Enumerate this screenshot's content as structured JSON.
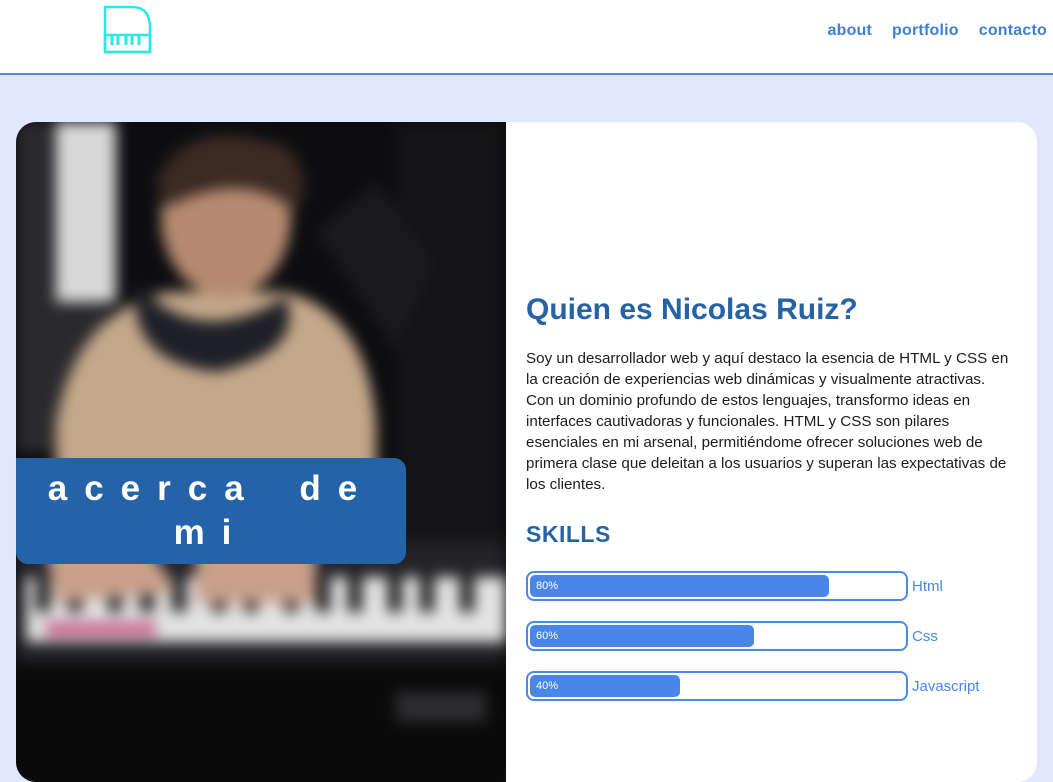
{
  "header": {
    "logo_icon": "piano-icon",
    "nav": [
      {
        "label": "about"
      },
      {
        "label": "portfolio"
      },
      {
        "label": "contacto"
      }
    ]
  },
  "about_badge": "acerca de mi",
  "profile": {
    "title": "Quien es Nicolas Ruiz?",
    "bio": "Soy un desarrollador web y aquí destaco la esencia de HTML y CSS en la creación de experiencias web dinámicas y visualmente atractivas. Con un dominio profundo de estos lenguajes, transformo ideas en interfaces cautivadoras y funcionales. HTML y CSS son pilares esenciales en mi arsenal, permitiéndome ofrecer soluciones web de primera clase que deleitan a los usuarios y superan las expectativas de los clientes."
  },
  "skills": {
    "title": "SKILLS",
    "items": [
      {
        "name": "Html",
        "percent": 80,
        "label": "80%"
      },
      {
        "name": "Css",
        "percent": 60,
        "label": "60%"
      },
      {
        "name": "Javascript",
        "percent": 40,
        "label": "40%"
      }
    ]
  },
  "colors": {
    "accent": "#4a86e8",
    "heading": "#2662a6",
    "page_background": "#e1e8fd",
    "logo": "#2ee6e6"
  }
}
